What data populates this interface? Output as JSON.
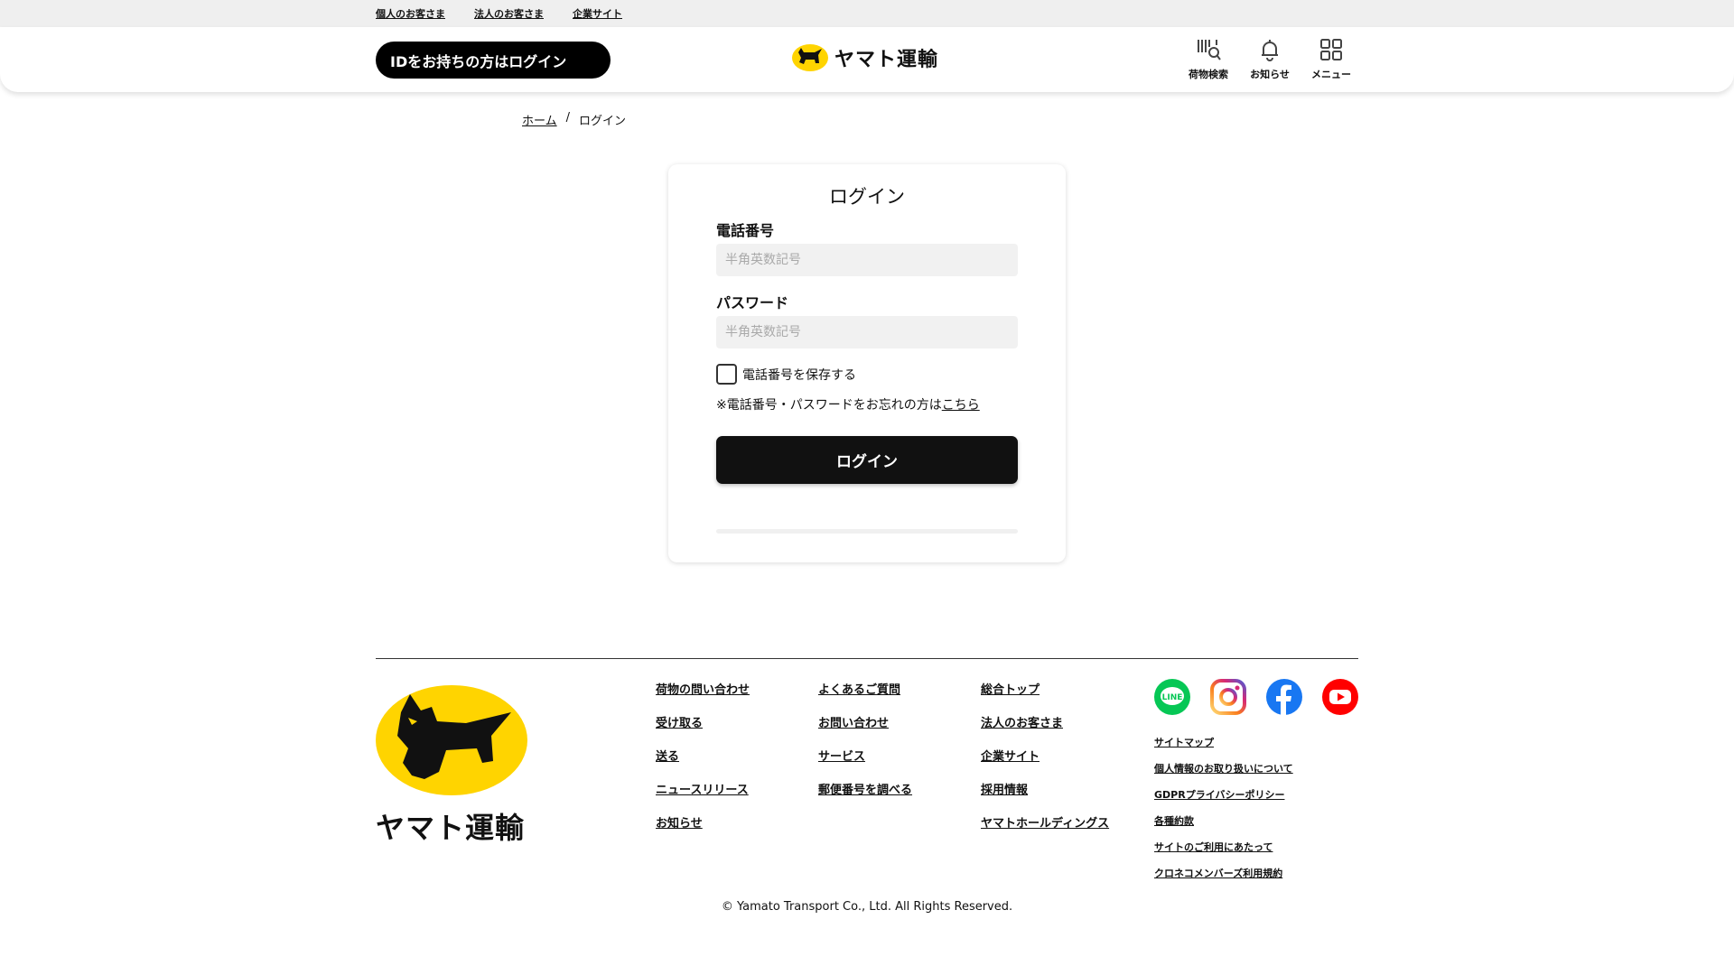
{
  "util_links": [
    "個人のお客さま",
    "法人のお客さま",
    "企業サイト"
  ],
  "header": {
    "id_login": "IDをお持ちの方はログイン",
    "brand": "ヤマト運輸",
    "nav": [
      {
        "label": "荷物検索",
        "icon": "package-search-icon"
      },
      {
        "label": "お知らせ",
        "icon": "bell-icon"
      },
      {
        "label": "メニュー",
        "icon": "grid-menu-icon"
      }
    ]
  },
  "breadcrumb": {
    "home": "ホーム",
    "separator": "/",
    "current": "ログイン"
  },
  "login_card": {
    "title": "ログイン",
    "phone_label": "電話番号",
    "phone_placeholder": "半角英数記号",
    "password_label": "パスワード",
    "password_placeholder": "半角英数記号",
    "remember_label": "電話番号を保存する",
    "forgot_text": "※電話番号・パスワードをお忘れの方は",
    "forgot_link": "こちら",
    "submit": "ログイン"
  },
  "footer": {
    "brand": "ヤマト運輸",
    "col1": [
      "荷物の問い合わせ",
      "受け取る",
      "送る",
      "ニュースリリース",
      "お知らせ"
    ],
    "col2": [
      "よくあるご質問",
      "お問い合わせ",
      "サービス",
      "郵便番号を調べる"
    ],
    "col3": [
      "総合トップ",
      "法人のお客さま",
      "企業サイト",
      "採用情報",
      "ヤマトホールディングス"
    ],
    "social": [
      "line-icon",
      "instagram-icon",
      "facebook-icon",
      "youtube-icon"
    ],
    "legal": [
      "サイトマップ",
      "個人情報のお取り扱いについて",
      "GDPRプライバシーポリシー",
      "各種約款",
      "サイトのご利用にあたって",
      "クロネコメンバーズ利用規約"
    ],
    "copyright": "© Yamato Transport Co., Ltd. All Rights Reserved."
  },
  "colors": {
    "brand_yellow": "#ffd400",
    "black": "#111111",
    "input_bg": "#f1f1f1"
  }
}
